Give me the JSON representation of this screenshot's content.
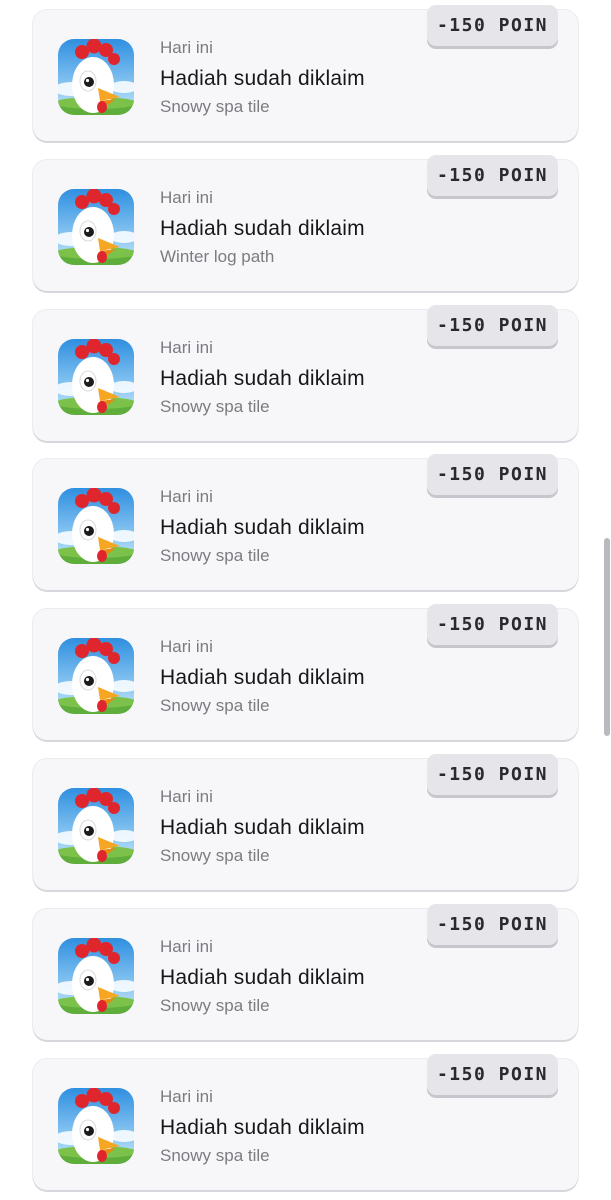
{
  "rewards": {
    "items": [
      {
        "date": "Hari ini",
        "title": "Hadiah sudah diklaim",
        "subtitle": "Snowy spa tile",
        "points": "-150 POIN",
        "icon": "rooster-app-icon"
      },
      {
        "date": "Hari ini",
        "title": "Hadiah sudah diklaim",
        "subtitle": "Winter log path",
        "points": "-150 POIN",
        "icon": "rooster-app-icon"
      },
      {
        "date": "Hari ini",
        "title": "Hadiah sudah diklaim",
        "subtitle": "Snowy spa tile",
        "points": "-150 POIN",
        "icon": "rooster-app-icon"
      },
      {
        "date": "Hari ini",
        "title": "Hadiah sudah diklaim",
        "subtitle": "Snowy spa tile",
        "points": "-150 POIN",
        "icon": "rooster-app-icon"
      },
      {
        "date": "Hari ini",
        "title": "Hadiah sudah diklaim",
        "subtitle": "Snowy spa tile",
        "points": "-150 POIN",
        "icon": "rooster-app-icon"
      },
      {
        "date": "Hari ini",
        "title": "Hadiah sudah diklaim",
        "subtitle": "Snowy spa tile",
        "points": "-150 POIN",
        "icon": "rooster-app-icon"
      },
      {
        "date": "Hari ini",
        "title": "Hadiah sudah diklaim",
        "subtitle": "Snowy spa tile",
        "points": "-150 POIN",
        "icon": "rooster-app-icon"
      },
      {
        "date": "Hari ini",
        "title": "Hadiah sudah diklaim",
        "subtitle": "Snowy spa tile",
        "points": "-150 POIN",
        "icon": "rooster-app-icon"
      }
    ]
  },
  "colors": {
    "card_background": "#f7f7fa",
    "badge_background": "#e5e5ea",
    "title_text": "#17171a",
    "secondary_text": "#7b7b80"
  }
}
